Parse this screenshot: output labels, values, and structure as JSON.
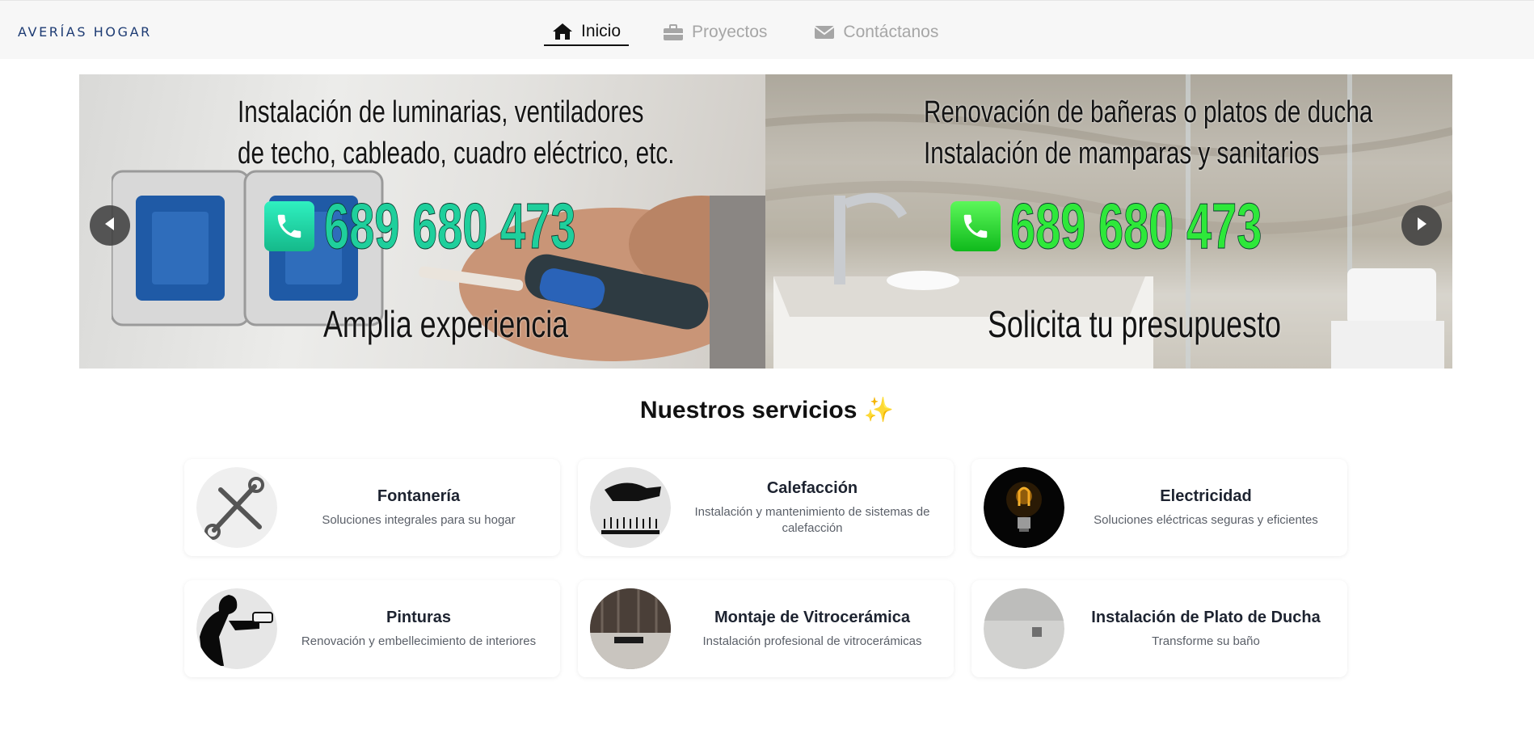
{
  "brand": "AVERÍAS HOGAR",
  "nav": [
    {
      "label": "Inicio",
      "icon": "home-icon",
      "active": true
    },
    {
      "label": "Proyectos",
      "icon": "briefcase-icon",
      "active": false
    },
    {
      "label": "Contáctanos",
      "icon": "envelope-icon",
      "active": false
    }
  ],
  "carousel": {
    "slides": [
      {
        "line1": "Instalación de luminarias, ventiladores",
        "line2": "de techo, cableado, cuadro eléctrico, etc.",
        "phone": "689 680 473",
        "tagline": "Amplia experiencia",
        "phone_color": "#1fcf9c"
      },
      {
        "line1": "Renovación de bañeras o platos de ducha",
        "line2": "Instalación de mamparas y sanitarios",
        "phone": "689 680 473",
        "tagline": "Solicita tu presupuesto",
        "phone_color": "#2ee83a"
      }
    ],
    "prev_icon": "chevron-left-icon",
    "next_icon": "chevron-right-icon"
  },
  "services": {
    "title": "Nuestros servicios ✨",
    "items": [
      {
        "title": "Fontanería",
        "desc": "Soluciones integrales para su hogar",
        "icon": "wrench-icon"
      },
      {
        "title": "Calefacción",
        "desc": "Instalación y mantenimiento de sistemas de calefacción",
        "icon": "heating-icon"
      },
      {
        "title": "Electricidad",
        "desc": "Soluciones eléctricas seguras y eficientes",
        "icon": "lightbulb-icon"
      },
      {
        "title": "Pinturas",
        "desc": "Renovación y embellecimiento de interiores",
        "icon": "painter-icon"
      },
      {
        "title": "Montaje de Vitrocerámica",
        "desc": "Instalación profesional de vitrocerámicas",
        "icon": "kitchen-icon"
      },
      {
        "title": "Instalación de Plato de Ducha",
        "desc": "Transforme su baño",
        "icon": "shower-tray-icon"
      }
    ]
  },
  "colors": {
    "brand": "#1d3b73",
    "nav_inactive": "#a6a6a6",
    "nav_active": "#111111"
  }
}
